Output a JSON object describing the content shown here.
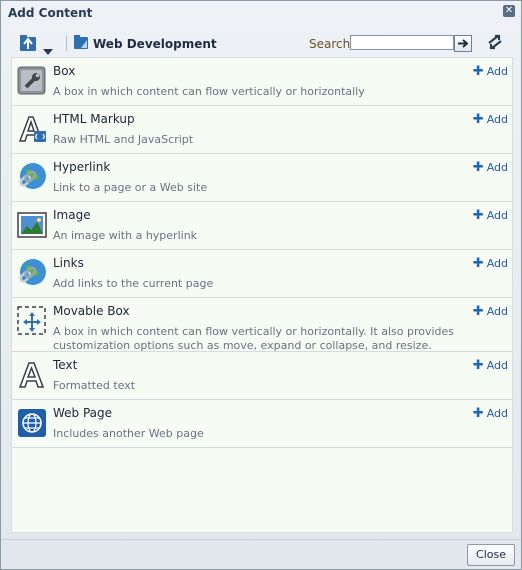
{
  "dialog": {
    "title": "Add Content",
    "close_glyph": "✕",
    "close_button": "Close"
  },
  "toolbar": {
    "crumb": "Web Development",
    "search_label": "Search",
    "search_value": "",
    "go_glyph": "➔"
  },
  "items": [
    {
      "name": "Box",
      "desc": "A box in which content can flow vertically or horizontally",
      "add": "Add",
      "icon": "box-icon"
    },
    {
      "name": "HTML Markup",
      "desc": "Raw HTML and JavaScript",
      "add": "Add",
      "icon": "html-markup-icon"
    },
    {
      "name": "Hyperlink",
      "desc": "Link to a page or a Web site",
      "add": "Add",
      "icon": "hyperlink-icon"
    },
    {
      "name": "Image",
      "desc": "An image with a hyperlink",
      "add": "Add",
      "icon": "image-icon"
    },
    {
      "name": "Links",
      "desc": "Add links to the current page",
      "add": "Add",
      "icon": "links-icon"
    },
    {
      "name": "Movable Box",
      "desc": "A box in which content can flow vertically or horizontally. It also provides customization options such as move, expand or collapse, and resize.",
      "add": "Add",
      "icon": "movable-box-icon"
    },
    {
      "name": "Text",
      "desc": "Formatted text",
      "add": "Add",
      "icon": "text-icon"
    },
    {
      "name": "Web Page",
      "desc": "Includes another Web page",
      "add": "Add",
      "icon": "web-page-icon"
    }
  ]
}
